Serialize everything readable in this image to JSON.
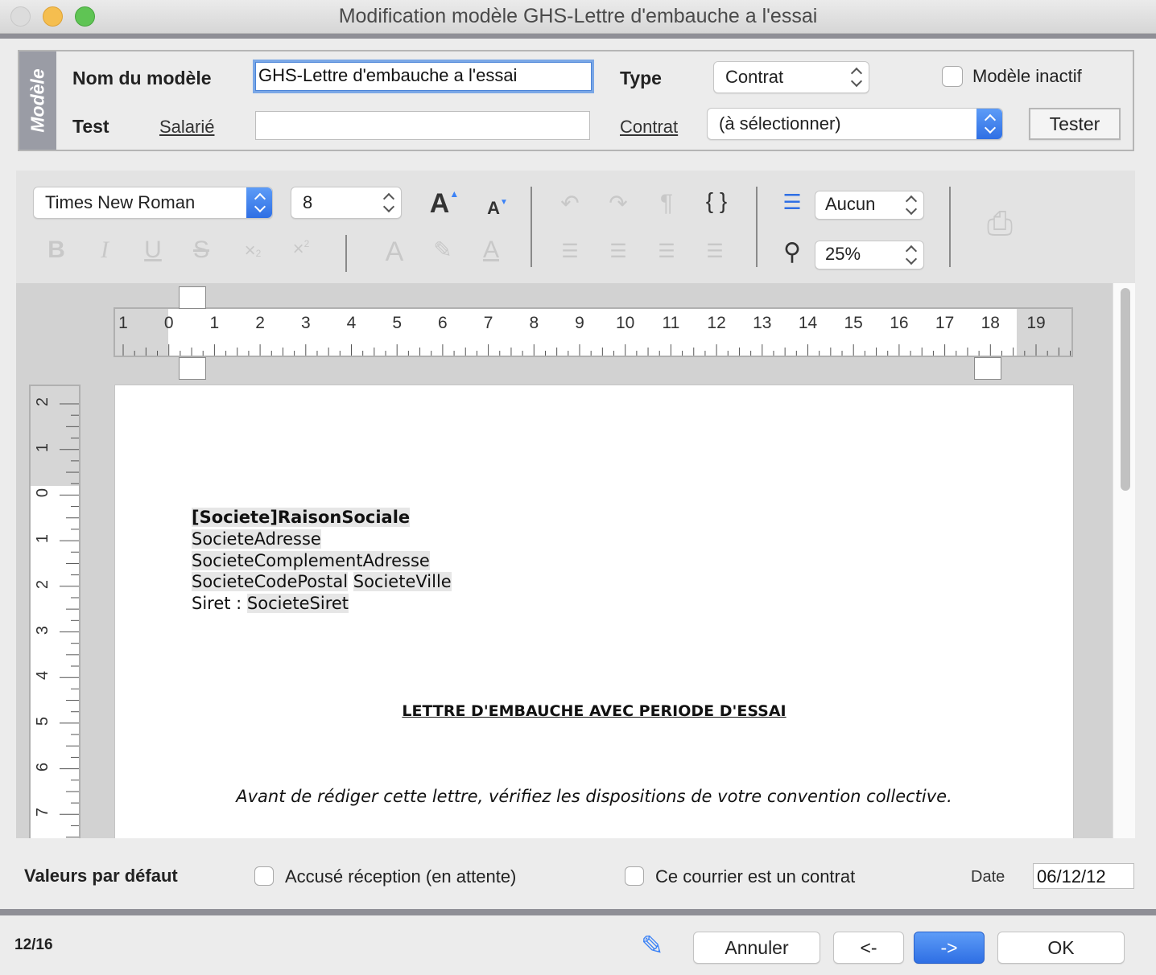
{
  "window": {
    "title": "Modification modèle GHS-Lettre d'embauche a l'essai"
  },
  "model": {
    "tab_label": "Modèle",
    "name_label": "Nom du modèle",
    "name_value": "GHS-Lettre d'embauche a l'essai",
    "type_label": "Type",
    "type_value": "Contrat",
    "inactive_label": "Modèle inactif",
    "test_label": "Test",
    "salarie_link": "Salarié",
    "salarie_value": "",
    "contrat_link": "Contrat",
    "contrat_value": "(à sélectionner)",
    "tester_button": "Tester"
  },
  "toolbar": {
    "font_family": "Times New Roman",
    "font_size": "8",
    "list_style": "Aucun",
    "zoom": "25%",
    "braces": "{ }",
    "pilcrow": "¶"
  },
  "ruler": {
    "h_numbers": [
      "1",
      "0",
      "1",
      "2",
      "3",
      "4",
      "5",
      "6",
      "7",
      "8",
      "9",
      "10",
      "11",
      "12",
      "13",
      "14",
      "15",
      "16",
      "17",
      "18",
      "19"
    ],
    "v_numbers": [
      "2",
      "1",
      "0",
      "1",
      "2",
      "3",
      "4",
      "5",
      "6",
      "7"
    ]
  },
  "document": {
    "company_name": "[Societe]RaisonSociale",
    "address": "SocieteAdresse",
    "address_complement": "SocieteComplementAdresse",
    "postal_code": "SocieteCodePostal",
    "city": "SocieteVille",
    "siret_label": "Siret : ",
    "siret_value": "SocieteSiret",
    "heading": "LETTRE D'EMBAUCHE AVEC PERIODE D'ESSAI",
    "note": "Avant de rédiger cette lettre, vérifiez les dispositions de votre convention collective."
  },
  "defaults": {
    "label": "Valeurs par défaut",
    "ack_label": "Accusé réception (en attente)",
    "contract_label": "Ce courrier est un contrat",
    "date_label": "Date",
    "date_value": "06/12/12"
  },
  "footer": {
    "counter": "12/16",
    "cancel_button": "Annuler",
    "prev_button": "<-",
    "next_button": "->",
    "ok_button": "OK"
  },
  "colors": {
    "accent": "#2f6fe4",
    "tab_grey": "#9a9ca5"
  }
}
